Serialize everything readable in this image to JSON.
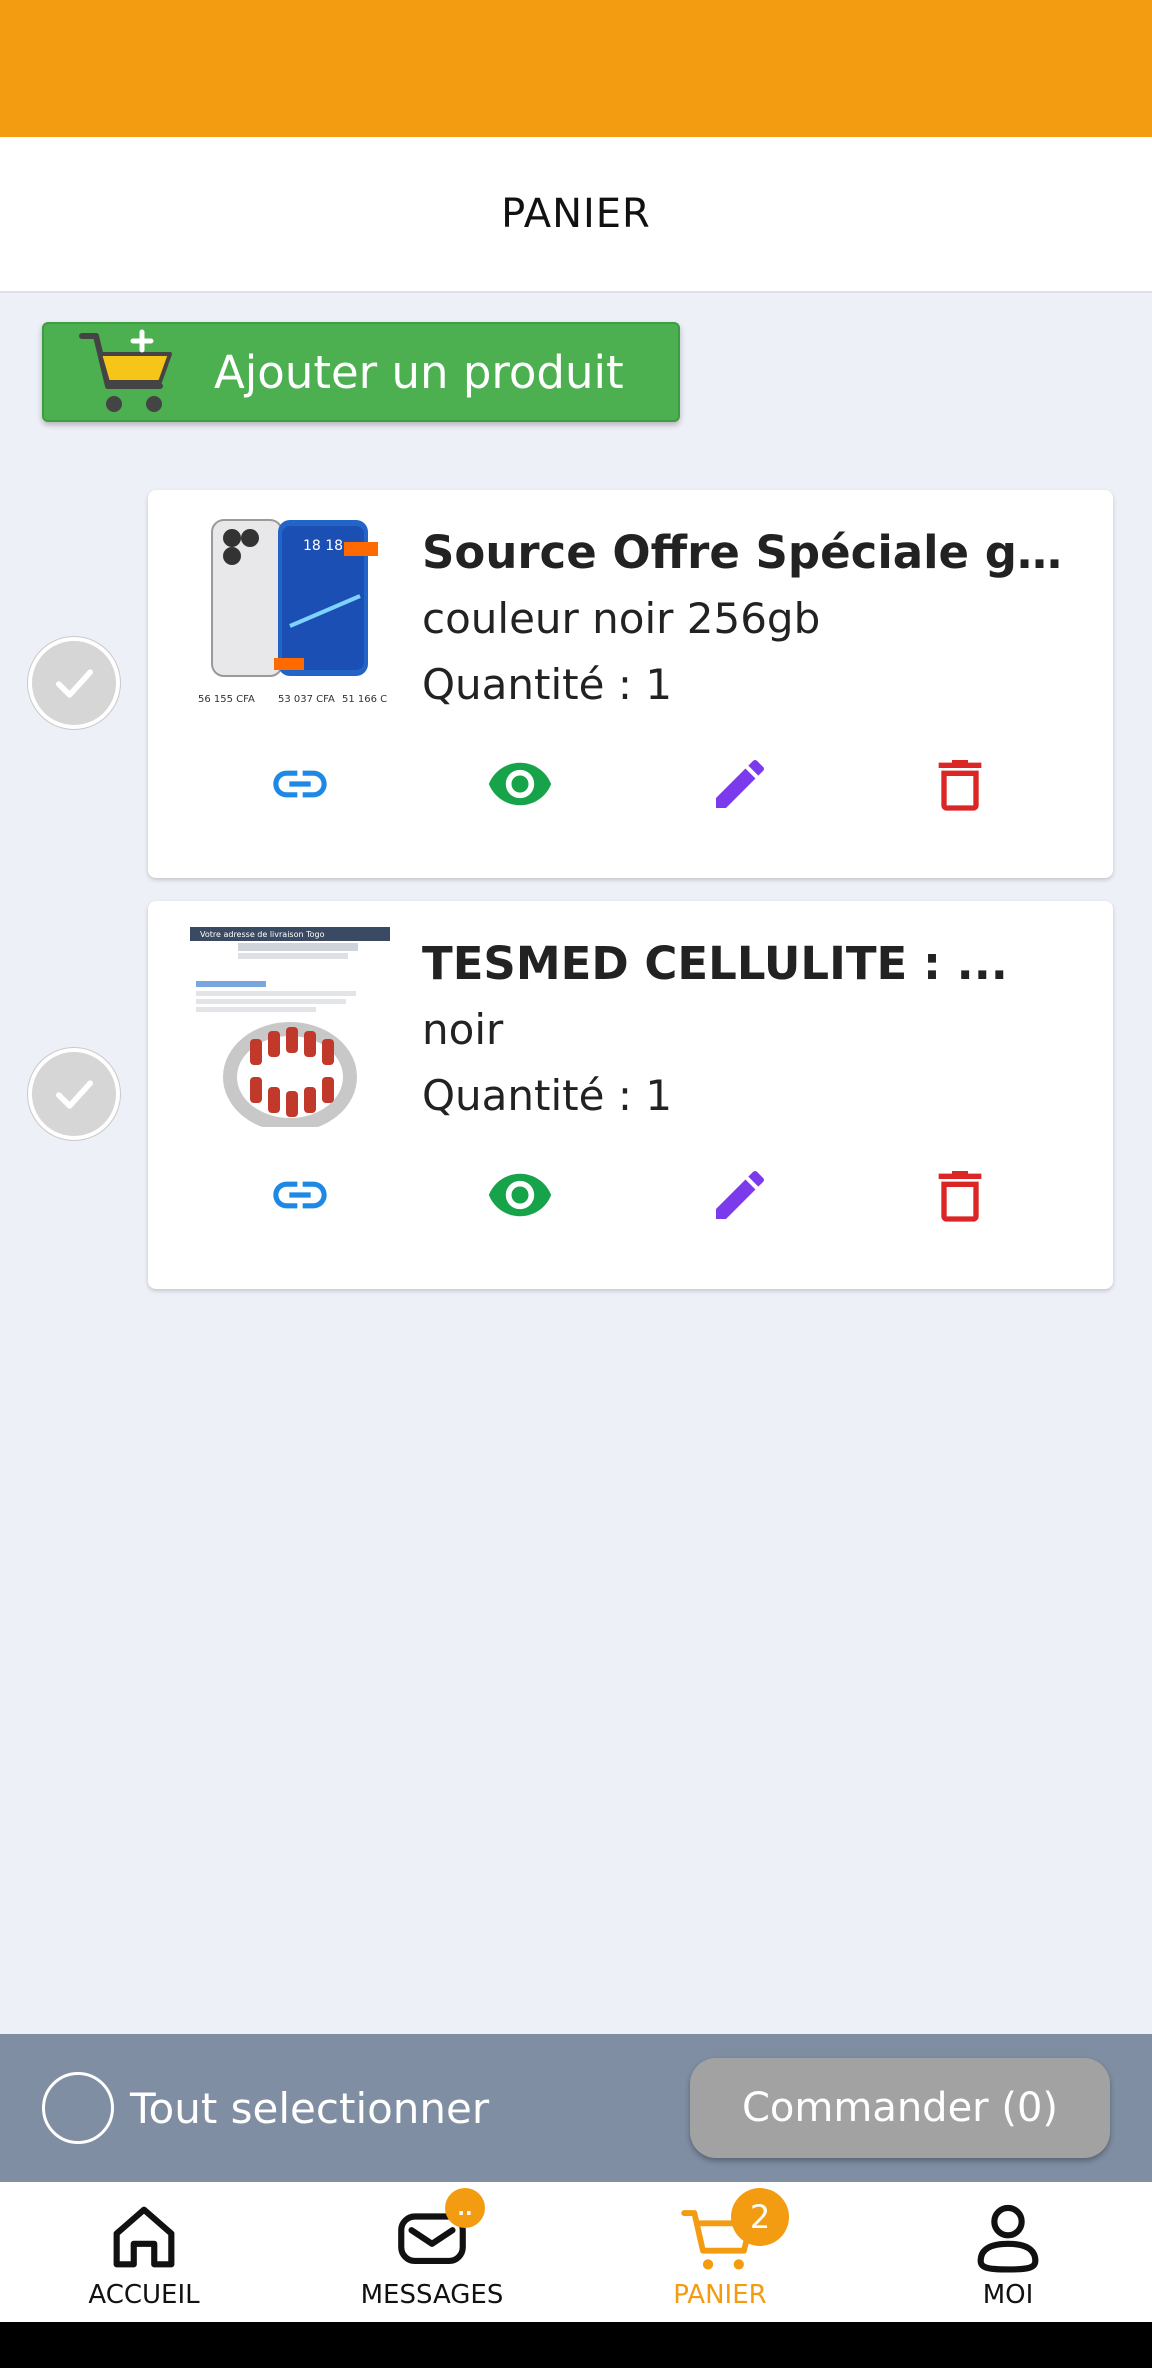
{
  "header": {
    "title": "PANIER"
  },
  "add_button": {
    "label": "Ajouter un produit"
  },
  "cart_items": [
    {
      "name": "Source Offre Spéciale gro...",
      "variant": "couleur noir 256gb",
      "quantity": "Quantité : 1"
    },
    {
      "name": "TESMED CELLULITE : ...",
      "variant": "noir",
      "quantity": "Quantité : 1"
    }
  ],
  "thumb1": {
    "prices": [
      "56 155 CFA",
      "53 037 CFA",
      "51 166 C"
    ],
    "screen_time": "18 18"
  },
  "thumb2": {
    "banner": "Votre adresse de livraison Togo"
  },
  "bottom": {
    "select_all_label": "Tout selectionner",
    "order_label": "Commander (0)"
  },
  "tabs": [
    {
      "label": "ACCUEIL",
      "icon": "home-icon"
    },
    {
      "label": "MESSAGES",
      "icon": "mail-icon",
      "badge": ".."
    },
    {
      "label": "PANIER",
      "icon": "cart-icon",
      "badge": "2"
    },
    {
      "label": "MOI",
      "icon": "user-icon"
    }
  ],
  "colors": {
    "accent": "#f39c12",
    "add_button": "#4caf50",
    "link": "#1e88e5",
    "view": "#16a34a",
    "edit": "#7c3aed",
    "delete": "#dc2626",
    "bottom_bar": "#7f8ea3"
  }
}
